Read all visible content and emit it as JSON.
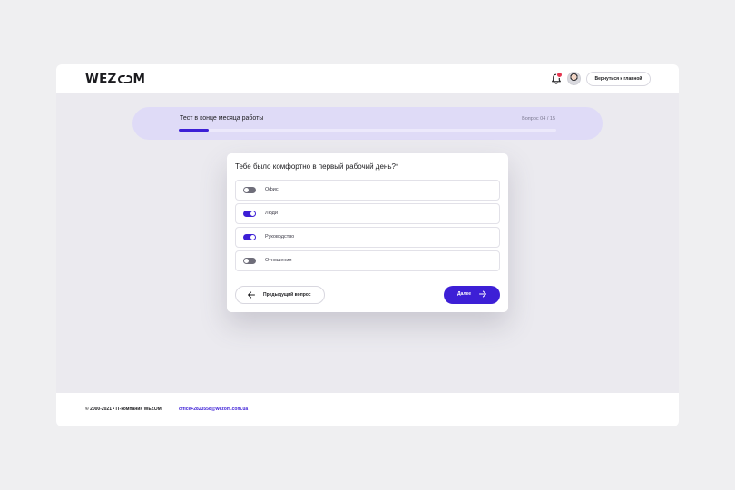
{
  "header": {
    "logo": {
      "prefix": "WEZ",
      "suffix": "M"
    },
    "back_label": "Вернуться к главной",
    "notification_icon": "bell-icon"
  },
  "progress": {
    "title": "Тест в конце месяца работы",
    "counter": "Вопрос 04 / 15",
    "fill_fraction": 0.08
  },
  "question": {
    "title": "Тебе было комфортно в первый рабочий день?*",
    "options": [
      {
        "label": "Офис",
        "checked": false
      },
      {
        "label": "Люди",
        "checked": true
      },
      {
        "label": "Руководство",
        "checked": true
      },
      {
        "label": "Отношения",
        "checked": false
      }
    ],
    "prev_label": "Предыдущий вопрос",
    "next_label": "Далее"
  },
  "footer": {
    "copyright": "© 2000-2021  •  IT-компания WEZOM",
    "email": "office+2823558@wezom.com.ua"
  },
  "colors": {
    "accent": "#3d1fd6",
    "progress_panel": "#dfdbf7",
    "badge": "#e5354f"
  }
}
